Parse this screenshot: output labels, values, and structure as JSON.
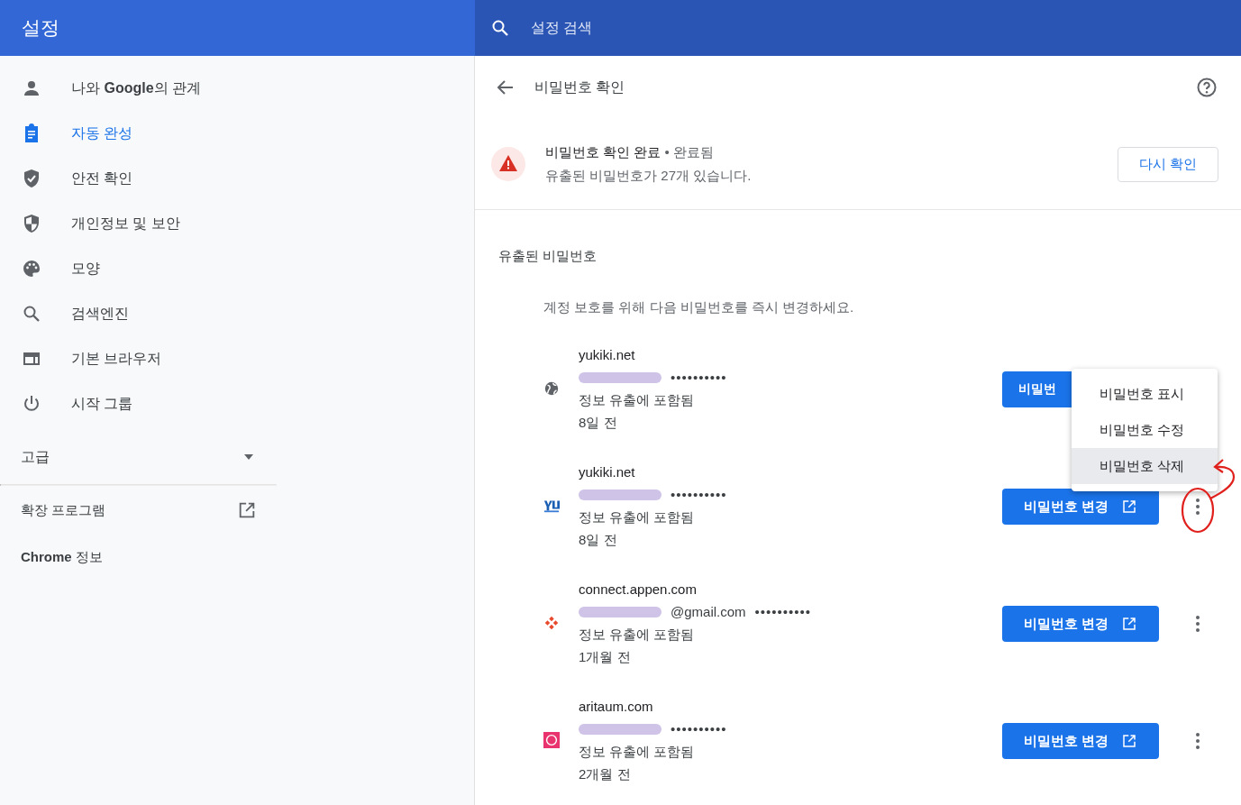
{
  "header": {
    "title": "설정",
    "search_placeholder": "설정 검색"
  },
  "sidebar": {
    "items": [
      {
        "label": "나와 **Google**의 관계",
        "kind": "person",
        "selected": false
      },
      {
        "label": "자동 완성",
        "kind": "clipboard",
        "selected": true
      },
      {
        "label": "안전 확인",
        "kind": "safety",
        "selected": false
      },
      {
        "label": "개인정보 및 보안",
        "kind": "privacy",
        "selected": false
      },
      {
        "label": "모양",
        "kind": "appearance",
        "selected": false
      },
      {
        "label": "검색엔진",
        "kind": "search",
        "selected": false
      },
      {
        "label": "기본 브라우저",
        "kind": "browser",
        "selected": false
      },
      {
        "label": "시작 그룹",
        "kind": "startup",
        "selected": false
      }
    ],
    "advanced": {
      "label": "고급",
      "expanded": false
    },
    "links": [
      {
        "label": "확장 프로그램",
        "external": true
      },
      {
        "label": "**Chrome** 정보",
        "external": false
      }
    ]
  },
  "main": {
    "page_title": "비밀번호 확인",
    "status": {
      "title": "비밀번호 확인 완료",
      "separator": "•",
      "state": "완료됨",
      "detail": "유출된 비밀번호가 27개 있습니다.",
      "button": "다시 확인"
    },
    "section_title": "유출된 비밀번호",
    "description": "계정 보호를 위해 다음 비밀번호를 즉시 변경하세요.",
    "rows": [
      {
        "site": "yukiki.net",
        "kind": "globe",
        "redacted": true,
        "password": "••••••••••",
        "status": "정보 유출에 포함됨",
        "age": "8일 전",
        "button": "비밀번",
        "button_icon": false
      },
      {
        "site": "yukiki.net",
        "kind": "lettermark",
        "redacted": true,
        "password": "••••••••••",
        "status": "정보 유출에 포함됨",
        "age": "8일 전",
        "button": "비밀번호 변경",
        "button_icon": true,
        "annotated": true,
        "menu": [
          {
            "label": "비밀번호 표시",
            "selected": false
          },
          {
            "label": "비밀번호 수정",
            "selected": false
          },
          {
            "label": "비밀번호 삭제",
            "selected": true
          }
        ]
      },
      {
        "site": "connect.appen.com",
        "kind": "diamond",
        "redacted": true,
        "username": "@gmail.com",
        "password": "••••••••••",
        "status": "정보 유출에 포함됨",
        "age": "1개월 전",
        "button": "비밀번호 변경",
        "button_icon": true
      },
      {
        "site": "aritaum.com",
        "kind": "ring",
        "redacted": true,
        "password": "••••••••••",
        "status": "정보 유출에 포함됨",
        "age": "2개월 전",
        "button": "비밀번호 변경",
        "button_icon": true
      }
    ]
  }
}
